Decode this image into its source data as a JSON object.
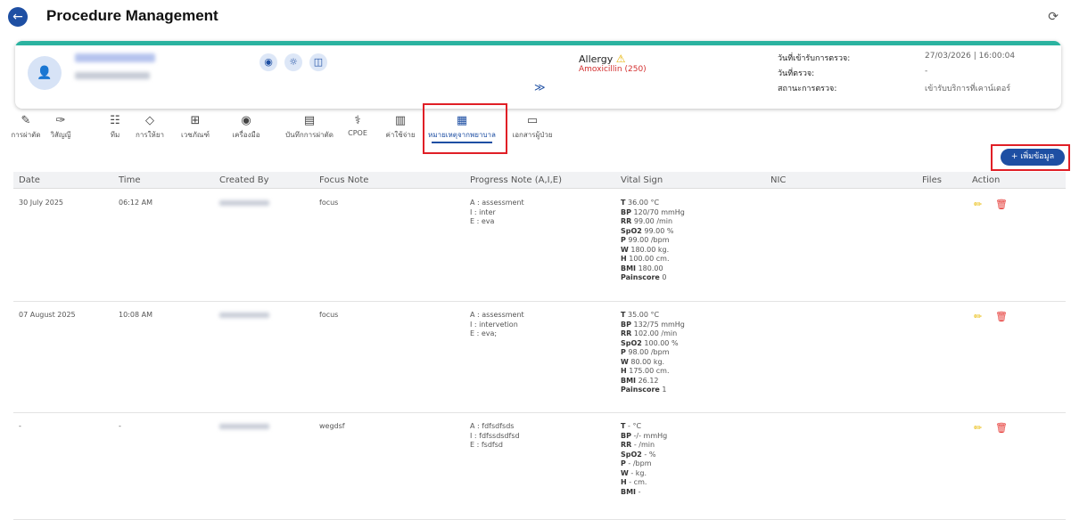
{
  "header": {
    "title": "Procedure Management",
    "back_icon": "←",
    "refresh_icon": "⟳"
  },
  "patient": {
    "avatar_icon": "👤",
    "quick_icons": [
      "◉",
      "☼",
      "◫"
    ],
    "expand_icon": "≫"
  },
  "allergy": {
    "label": "Allergy",
    "warn_icon": "⚠",
    "value": "Amoxicillin (250)"
  },
  "visit": {
    "labels": [
      "วันที่เข้ารับการตรวจ:",
      "วันที่ตรวจ:",
      "สถานะการตรวจ:"
    ],
    "values": [
      "27/03/2026 | 16:00:04",
      "-",
      "เข้ารับบริการที่เคาน์เตอร์"
    ]
  },
  "tabs": [
    {
      "icon": "✎",
      "label": "การผ่าตัด"
    },
    {
      "icon": "✑",
      "label": "วิสัญญี"
    },
    {
      "icon": "☷",
      "label": "ทีม"
    },
    {
      "icon": "◇",
      "label": "การให้ยา"
    },
    {
      "icon": "⊞",
      "label": "เวชภัณฑ์"
    },
    {
      "icon": "◉",
      "label": "เครื่องมือ"
    },
    {
      "icon": "▤",
      "label": "บันทึกการผ่าตัด"
    },
    {
      "icon": "⚕",
      "label": "CPOE"
    },
    {
      "icon": "▥",
      "label": "ค่าใช้จ่าย"
    },
    {
      "icon": "▦",
      "label": "หมายเหตุจากพยาบาล"
    },
    {
      "icon": "▭",
      "label": "เอกสารผู้ป่วย"
    }
  ],
  "add_button": {
    "label": "+ เพิ่มข้อมูล"
  },
  "table": {
    "columns": [
      "Date",
      "Time",
      "Created By",
      "Focus Note",
      "Progress Note (A,I,E)",
      "Vital Sign",
      "NIC",
      "Files",
      "Action"
    ],
    "rows": [
      {
        "date": "30 July 2025",
        "time": "06:12 AM",
        "focus": "focus",
        "progress": [
          [
            "A :",
            "assessment"
          ],
          [
            "I :",
            "inter"
          ],
          [
            "E :",
            "eva"
          ]
        ],
        "vitals": [
          [
            "T",
            "36.00 °C"
          ],
          [
            "BP",
            "120/70 mmHg"
          ],
          [
            "RR",
            "99.00 /min"
          ],
          [
            "SpO2",
            "99.00 %"
          ],
          [
            "P",
            "99.00 /bpm"
          ],
          [
            "W",
            "180.00 kg."
          ],
          [
            "H",
            "100.00 cm."
          ],
          [
            "BMI",
            "180.00"
          ],
          [
            "Painscore",
            "0"
          ]
        ]
      },
      {
        "date": "07 August 2025",
        "time": "10:08 AM",
        "focus": "focus",
        "progress": [
          [
            "A :",
            "assessment"
          ],
          [
            "I :",
            "intervetion"
          ],
          [
            "E :",
            "eva;"
          ]
        ],
        "vitals": [
          [
            "T",
            "35.00 °C"
          ],
          [
            "BP",
            "132/75 mmHg"
          ],
          [
            "RR",
            "102.00 /min"
          ],
          [
            "SpO2",
            "100.00 %"
          ],
          [
            "P",
            "98.00 /bpm"
          ],
          [
            "W",
            "80.00 kg."
          ],
          [
            "H",
            "175.00 cm."
          ],
          [
            "BMI",
            "26.12"
          ],
          [
            "Painscore",
            "1"
          ]
        ]
      },
      {
        "date": "-",
        "time": "-",
        "focus": "wegdsf",
        "progress": [
          [
            "A :",
            "fdfsdfsds"
          ],
          [
            "I :",
            "fdfssdsdfsd"
          ],
          [
            "E :",
            "fsdfsd"
          ]
        ],
        "vitals": [
          [
            "T",
            "- °C"
          ],
          [
            "BP",
            "-/- mmHg"
          ],
          [
            "RR",
            "- /min"
          ],
          [
            "SpO2",
            "- %"
          ],
          [
            "P",
            "- /bpm"
          ],
          [
            "W",
            "- kg."
          ],
          [
            "H",
            "- cm."
          ],
          [
            "BMI",
            "-"
          ]
        ]
      }
    ],
    "edit_icon": "✏",
    "delete_icon": "🗑"
  },
  "colors": {
    "primary": "#1e4fa3",
    "accent": "#2bb3a0",
    "highlight": "#e01f26",
    "danger": "#e53935",
    "warning": "#e8b800"
  }
}
